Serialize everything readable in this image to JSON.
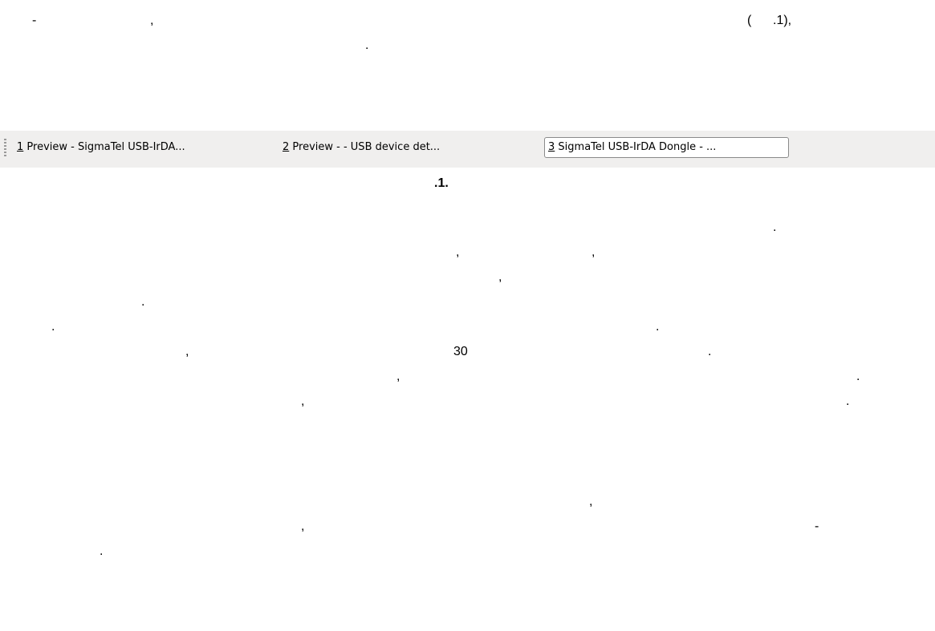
{
  "paragraph_1": {
    "dash": "-",
    "comma": ",",
    "paren_ref": "(      .1),",
    "period": "."
  },
  "taskbar": {
    "items": [
      {
        "accel": "1",
        "label": " Preview - SigmaTel USB-IrDA...",
        "active": false
      },
      {
        "accel": "2",
        "label": " Preview -  - USB device det...",
        "active": false
      },
      {
        "accel": "3",
        "label": " SigmaTel USB-IrDA Dongle - ...",
        "active": true
      }
    ]
  },
  "figure_caption": ".1.",
  "paragraph_2": {
    "p1": ".",
    "c1": ",",
    "c2": ",",
    "c3": ",",
    "p2": ".",
    "p3": ".",
    "p4": ".",
    "c4": ",",
    "number": "30",
    "p5": ".",
    "c5": ",",
    "p6": ".",
    "c6": ",",
    "p7": "."
  },
  "paragraph_3": {
    "c1": ",",
    "c2": ",",
    "dash": "-",
    "period": "."
  }
}
